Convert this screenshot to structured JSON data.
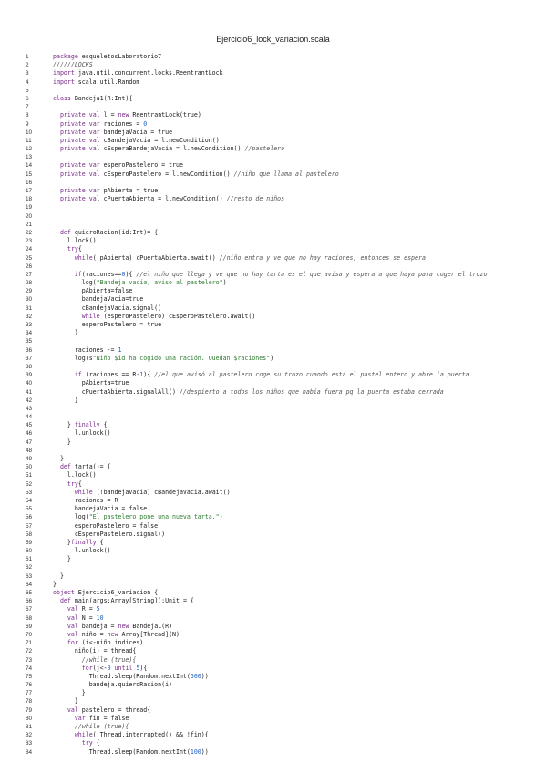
{
  "title": "Ejercicio6_lock_variacion.scala",
  "code_lines": [
    "package esqueletosLaboratorio7",
    "//////LOCKS",
    "import java.util.concurrent.locks.ReentrantLock",
    "import scala.util.Random",
    "",
    "class Bandeja1(R:Int){",
    "",
    "  private val l = new ReentrantLock(true)",
    "  private var raciones = 0",
    "  private var bandejaVacia = true",
    "  private val cBandejaVacia = l.newCondition()",
    "  private val cEsperaBandejaVacia = l.newCondition() //pastelero",
    "",
    "  private var esperoPastelero = true",
    "  private val cEsperoPastelero = l.newCondition() //niño que llama al pastelero",
    "",
    "  private var pAbierta = true",
    "  private val cPuertaAbierta = l.newCondition() //resto de niños",
    "",
    "",
    "",
    "  def quieroRacion(id:Int)= {",
    "    l.lock()",
    "    try{",
    "      while(!pAbierta) cPuertaAbierta.await() //niño entra y ve que no hay raciones, entonces se espera",
    "",
    "      if(raciones==0){ //el niño que llega y ve que no hay tarta es el que avisa y espera a que haya para coger el trozo",
    "        log(\"Bandeja vacía, aviso al pastelero\")",
    "        pAbierta=false",
    "        bandejaVacia=true",
    "        cBandejaVacia.signal()",
    "        while (esperoPastelero) cEsperoPastelero.await()",
    "        esperoPastelero = true",
    "      }",
    "",
    "      raciones -= 1",
    "      log(s\"Niño $id ha cogido una ración. Quedan $raciones\")",
    "",
    "      if (raciones == R-1){ //el que avisó al pastelero coge su trozo cuando está el pastel entero y abre la puerta",
    "        pAbierta=true",
    "        cPuertaAbierta.signalAll() //despierto a todos los niños que había fuera pq la puerta estaba cerrada",
    "      }",
    "",
    "",
    "    } finally {",
    "      l.unlock()",
    "    }",
    "",
    "  }",
    "  def tarta()= {",
    "    l.lock()",
    "    try{",
    "      while (!bandejaVacia) cBandejaVacia.await()",
    "      raciones = R",
    "      bandejaVacia = false",
    "      log(\"El pastelero pone una nueva tarta.\")",
    "      esperoPastelero = false",
    "      cEsperoPastelero.signal()",
    "    }finally {",
    "      l.unlock()",
    "    }",
    "",
    "  }",
    "}",
    "object Ejercicio6_variacion {",
    "  def main(args:Array[String]):Unit = {",
    "    val R = 5",
    "    val N = 10",
    "    val bandeja = new Bandeja1(R)",
    "    val niño = new Array[Thread](N)",
    "    for (i<-niño.indices)",
    "      niño(i) = thread{",
    "        //while (true){",
    "        for(j<-0 until 5){",
    "          Thread.sleep(Random.nextInt(500))",
    "          bandeja.quieroRacion(i)",
    "        }",
    "      }",
    "    val pastelero = thread{",
    "      var fin = false",
    "      //while (true){",
    "      while(!Thread.interrupted() && !fin){",
    "        try {",
    "          Thread.sleep(Random.nextInt(100))"
  ]
}
